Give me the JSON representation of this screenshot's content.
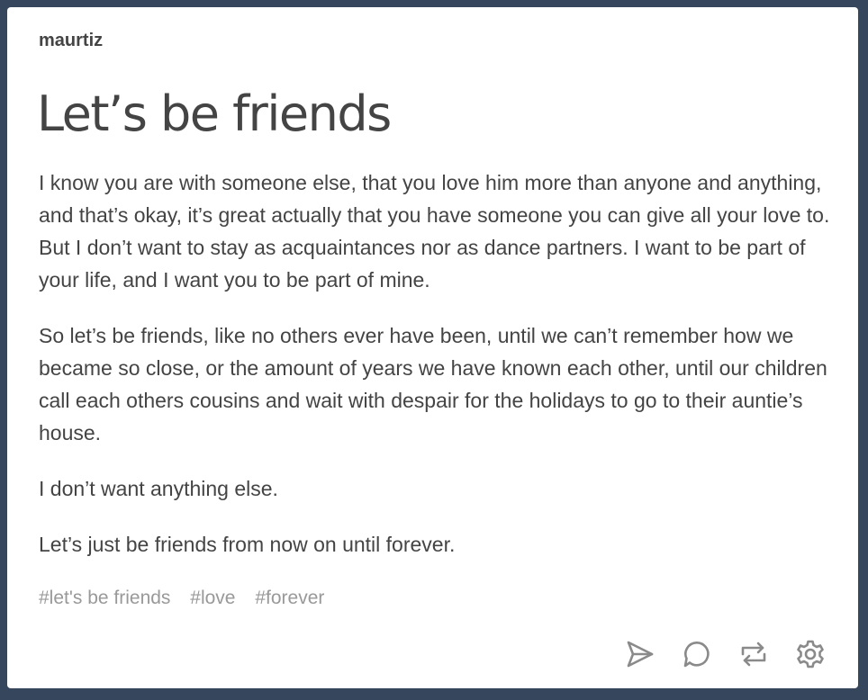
{
  "post": {
    "author": "maurtiz",
    "title": "Let’s be friends",
    "paragraphs": [
      "I know you are with someone else, that you love him more than anyone and anything, and that’s okay, it’s great actually that you have someone you can give all your love to. But I don’t want to stay as acquaintances nor as dance partners. I want to be part of your life, and I want you to be part of mine.",
      "So let’s be friends, like no others ever have been, until we can’t remember how we became so close, or the amount of years we have known each other, until our children call each others cousins and wait with despair for the holidays to go to their auntie’s house.",
      "I don’t want anything else.",
      "Let’s just be friends from now on until forever."
    ],
    "tags": [
      "#let's be friends",
      "#love",
      "#forever"
    ]
  },
  "actions": {
    "share_icon": "paper-plane-icon",
    "reply_icon": "speech-bubble-icon",
    "reblog_icon": "reblog-icon",
    "settings_icon": "gear-icon"
  },
  "colors": {
    "background": "#36465d",
    "card": "#ffffff",
    "text": "#444444",
    "tag": "#999999",
    "icon": "#8a8a8a"
  }
}
